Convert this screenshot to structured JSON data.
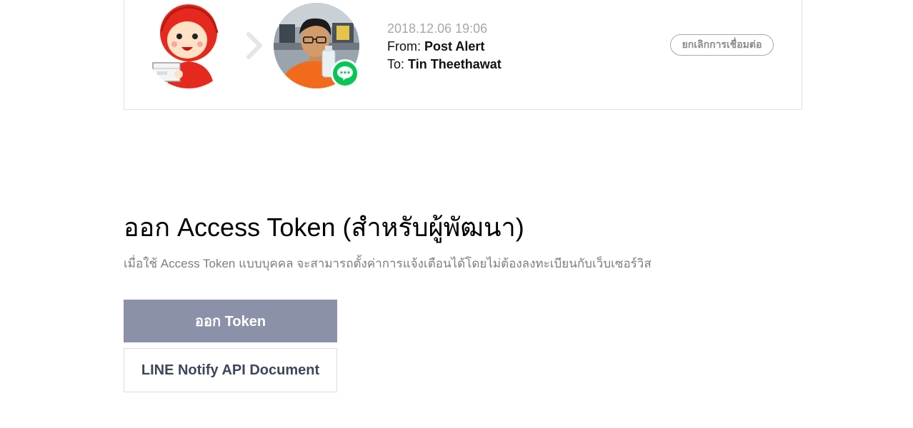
{
  "connection": {
    "date": "2018.12.06 19:06",
    "from_label": "From:",
    "from_name": "Post Alert",
    "to_label": "To:",
    "to_name": "Tin Theethawat",
    "disconnect_label": "ยกเลิกการเชื่อมต่อ",
    "icons": {
      "from_avatar": "mascot-avatar",
      "separator": "chevron-right-icon",
      "to_avatar": "user-avatar",
      "badge": "line-chat-icon"
    },
    "colors": {
      "line_green": "#06c755",
      "mascot_red": "#e5291e"
    }
  },
  "developer": {
    "title": "ออก Access Token (สำหรับผู้พัฒนา)",
    "description": "เมื่อใช้ Access Token แบบบุคคล จะสามารถตั้งค่าการแจ้งเตือนได้โดยไม่ต้องลงทะเบียนกับเว็บเซอร์วิส",
    "issue_button": "ออก Token",
    "doc_button": "LINE Notify API Document",
    "colors": {
      "issue_button_bg": "#8b91a9",
      "doc_button_text": "#3f455a"
    }
  }
}
